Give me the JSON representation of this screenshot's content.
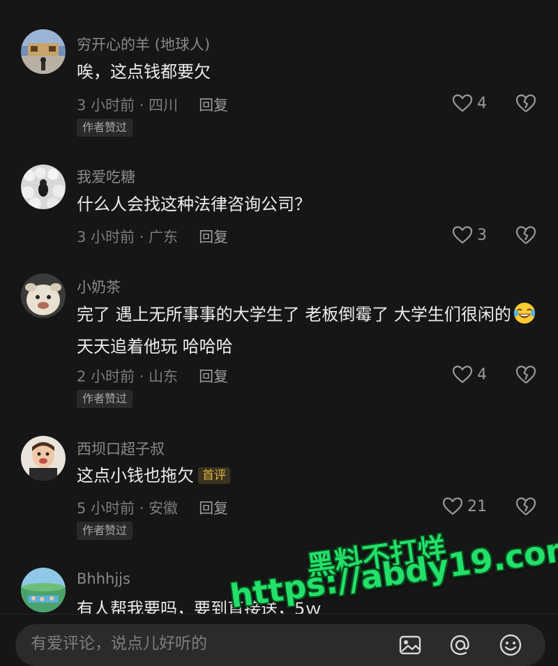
{
  "comments": [
    {
      "username": "穷开心的羊 (地球人)",
      "text": "唉，这点钱都要欠",
      "meta": "3 小时前 · 四川",
      "reply": "回复",
      "likes": "4",
      "author_liked": "作者赞过"
    },
    {
      "username": "我爱吃糖",
      "text": "什么人会找这种法律咨询公司？",
      "meta": "3 小时前 · 广东",
      "reply": "回复",
      "likes": "3"
    },
    {
      "username": "小奶茶",
      "text_part1": "完了 遇上无所事事的大学生了 老板倒霉了 大学生们很闲的",
      "text_part2": "天天追着他玩  哈哈哈",
      "meta": "2 小时前 · 山东",
      "reply": "回复",
      "likes": "4",
      "author_liked": "作者赞过"
    },
    {
      "username": "西坝口超子叔",
      "text": "这点小钱也拖欠",
      "badge": "首评",
      "meta": "5 小时前 · 安徽",
      "reply": "回复",
      "likes": "21",
      "author_liked": "作者赞过"
    },
    {
      "username": "Bhhhjjs",
      "text": "有人帮我要吗，要到直接送，5ｗ"
    }
  ],
  "input": {
    "placeholder": "有爱评论，说点儿好听的"
  },
  "watermark": {
    "line1": "黑料不打烊",
    "line2": "https://abdy19.com"
  },
  "colors": {
    "background": "#161616",
    "badge_first": "#e0b53c",
    "watermark": "#22e06a"
  },
  "icons": [
    "heart-icon",
    "broken-heart-icon",
    "image-icon",
    "at-icon",
    "emoji-icon",
    "laughing-emoji-icon"
  ]
}
